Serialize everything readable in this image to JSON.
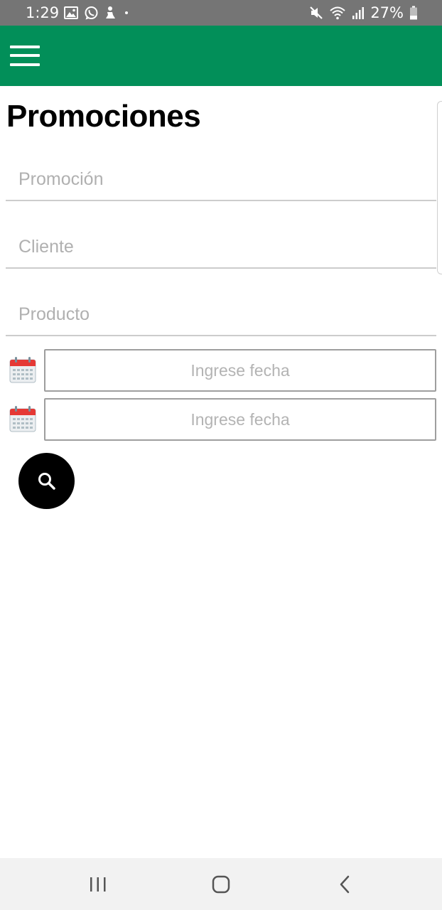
{
  "status_bar": {
    "time": "1:29",
    "battery_text": "27%",
    "left_icons": [
      "image-icon",
      "whatsapp-icon",
      "person-icon",
      "dot-icon"
    ],
    "right_icons": [
      "mute-icon",
      "wifi-icon",
      "signal-icon",
      "battery-icon"
    ]
  },
  "app_bar": {
    "color": "#028f59",
    "menu_icon": "hamburger-menu-icon"
  },
  "page": {
    "title": "Promociones"
  },
  "fields": {
    "promocion_placeholder": "Promoción",
    "cliente_placeholder": "Cliente",
    "producto_placeholder": "Producto"
  },
  "date_filters": {
    "from_placeholder": "Ingrese fecha",
    "to_placeholder": "Ingrese fecha",
    "icon": "calendar-icon"
  },
  "search": {
    "icon": "search-icon"
  },
  "nav_bar": {
    "items": [
      "recent-apps-icon",
      "home-icon",
      "back-icon"
    ]
  }
}
